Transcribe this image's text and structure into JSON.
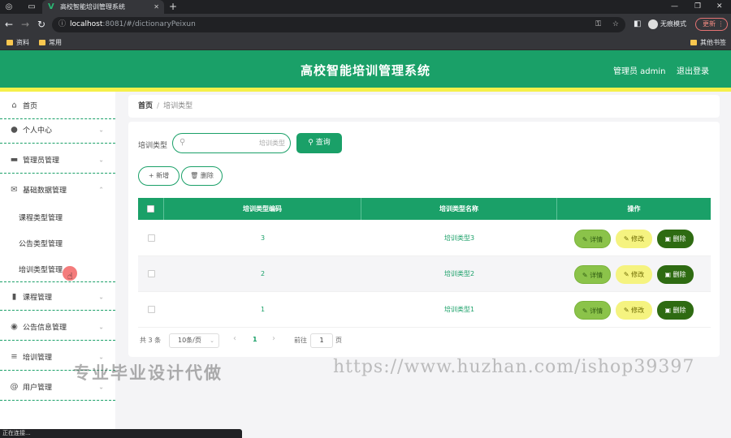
{
  "browser": {
    "tab_title": "高校智能培训管理系统",
    "url_host": "localhost",
    "url_path": ":8081/#/dictionaryPeixun",
    "profile_label": "无痕模式",
    "update_label": "更新",
    "bookmarks": [
      "资料",
      "常用"
    ],
    "other_bookmarks": "其他书签",
    "status_text": "正在连接..."
  },
  "header": {
    "title": "高校智能培训管理系统",
    "user": "管理员 admin",
    "logout": "退出登录"
  },
  "sidebar": {
    "items": [
      {
        "label": "首页",
        "icon": "home-icon"
      },
      {
        "label": "个人中心",
        "icon": "user-icon"
      },
      {
        "label": "管理员管理",
        "icon": "card-icon"
      },
      {
        "label": "基础数据管理",
        "icon": "mail-icon"
      },
      {
        "label": "课程管理",
        "icon": "chart-icon"
      },
      {
        "label": "公告信息管理",
        "icon": "compass-icon"
      },
      {
        "label": "培训管理",
        "icon": "list-icon"
      },
      {
        "label": "用户管理",
        "icon": "at-icon"
      }
    ],
    "sub_items": [
      "课程类型管理",
      "公告类型管理",
      "培训类型管理"
    ]
  },
  "breadcrumb": {
    "home": "首页",
    "current": "培训类型"
  },
  "search": {
    "label": "培训类型",
    "placeholder": "培训类型",
    "button": "查询"
  },
  "actions": {
    "add": "新增",
    "delete": "删除"
  },
  "table": {
    "headers": [
      "培训类型编码",
      "培训类型名称",
      "操作"
    ],
    "rows": [
      {
        "code": "3",
        "name": "培训类型3"
      },
      {
        "code": "2",
        "name": "培训类型2"
      },
      {
        "code": "1",
        "name": "培训类型1"
      }
    ],
    "row_actions": {
      "detail": "详情",
      "edit": "修改",
      "delete": "删除"
    }
  },
  "pagination": {
    "total": "共 3 条",
    "page_size": "10条/页",
    "prev": "‹",
    "current": "1",
    "next": "›",
    "goto_label": "前往",
    "goto_value": "1",
    "page_unit": "页"
  },
  "watermark": {
    "text1": "专业毕业设计代做",
    "text2": "https://www.huzhan.com/ishop39397"
  },
  "colors": {
    "primary": "#1aa068",
    "accent_bar": "#f5f04a",
    "detail": "#8bc34a",
    "edit": "#f5f380",
    "delete": "#2e6b12"
  }
}
